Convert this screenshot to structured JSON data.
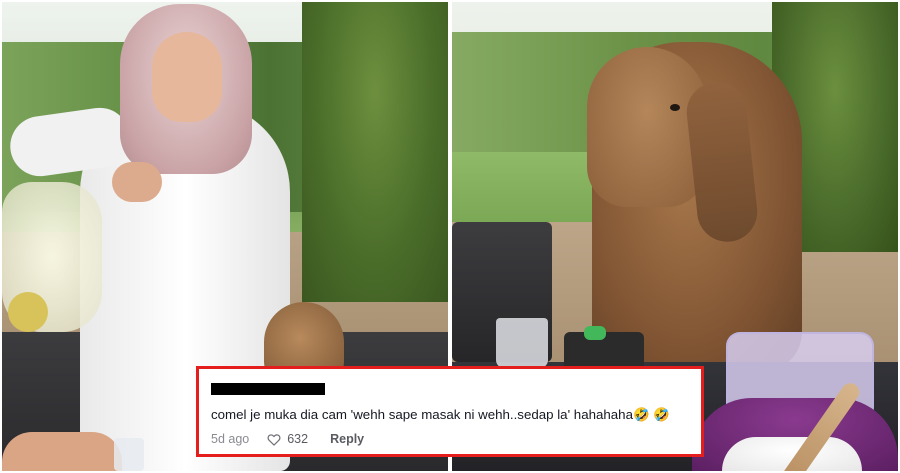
{
  "comment": {
    "text": "comel je muka dia cam 'wehh sape masak ni wehh..sedap la' hahahaha🤣 🤣",
    "time_ago": "5d ago",
    "like_count": "632",
    "reply_label": "Reply",
    "heart_icon": "heart-outline-icon",
    "border_color": "#e41d1d"
  }
}
